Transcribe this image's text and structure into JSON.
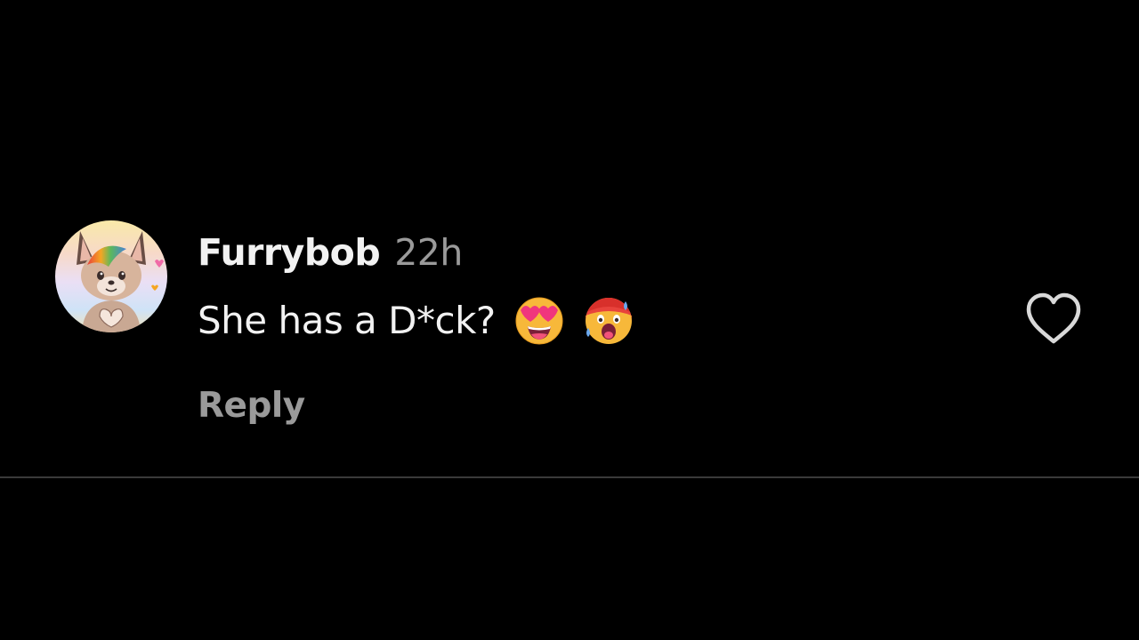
{
  "comment": {
    "username": "Furrybob",
    "timestamp": "22h",
    "text": "She has a D*ck?",
    "emojis": [
      "smiling-face-with-heart-eyes",
      "hot-face-shocked"
    ],
    "reply_label": "Reply",
    "liked": false
  },
  "icons": {
    "like": "heart-outline-icon",
    "avatar": "fox-avatar"
  },
  "colors": {
    "background": "#000000",
    "primary_text": "#f2f2f2",
    "secondary_text": "#9a9a9a",
    "divider": "#3a3a3a"
  }
}
